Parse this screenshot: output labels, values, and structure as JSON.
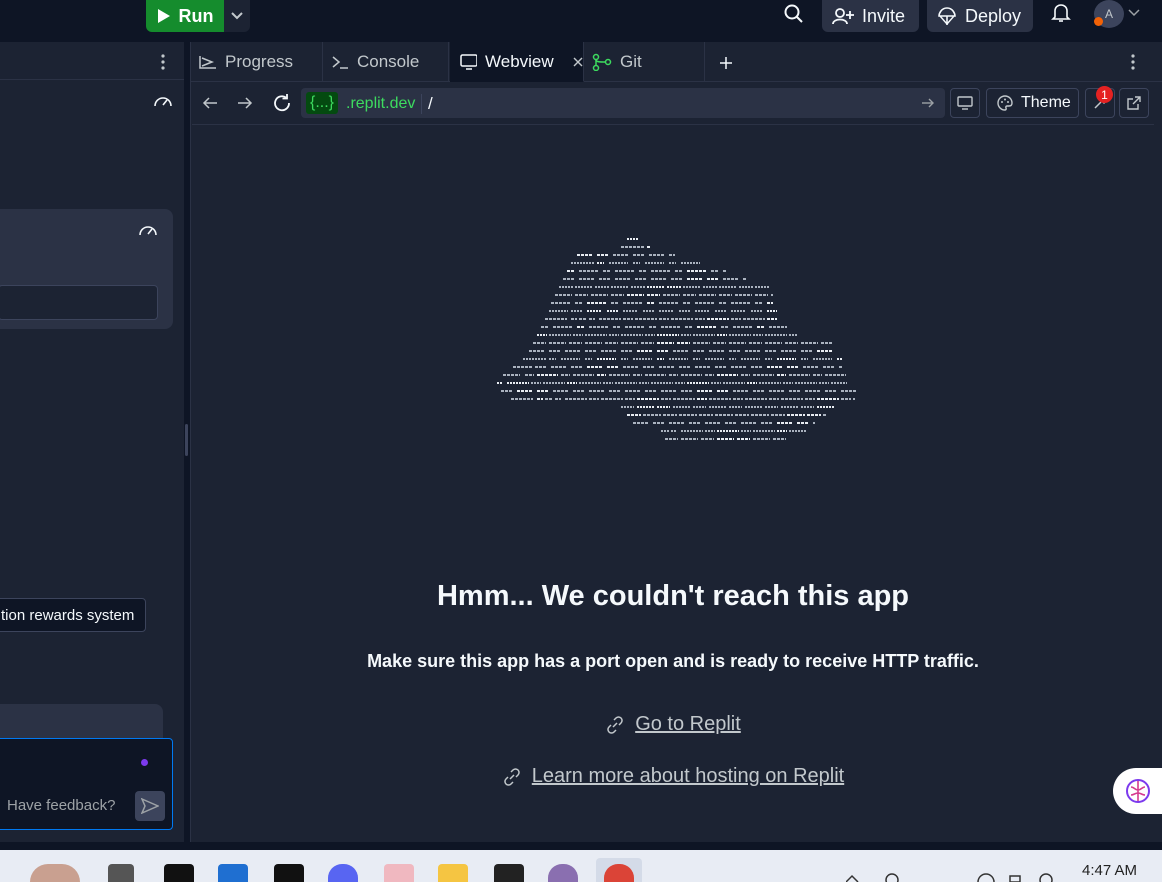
{
  "topbar": {
    "run_label": "Run",
    "invite_label": "Invite",
    "deploy_label": "Deploy",
    "avatar_initial": "A"
  },
  "left_panel": {
    "reward_text": "tion rewards system",
    "feedback_placeholder": "Have feedback?"
  },
  "tabs": [
    {
      "label": "Progress",
      "icon": "progress-icon"
    },
    {
      "label": "Console",
      "icon": "terminal-icon"
    },
    {
      "label": "Webview",
      "icon": "monitor-icon",
      "active": true
    },
    {
      "label": "Git",
      "icon": "git-icon"
    }
  ],
  "urlbar": {
    "badge": "{...}",
    "domain": ".replit.dev",
    "path": "/",
    "theme_label": "Theme",
    "notification_count": "1"
  },
  "webview": {
    "heading": "Hmm... We couldn't reach this app",
    "subtext": "Make sure this app has a port open and is ready to receive HTTP traffic.",
    "link1": "Go to Replit",
    "link2": "Learn more about hosting on Replit"
  },
  "taskbar": {
    "time": "4:47 AM"
  },
  "colors": {
    "run_green": "#158c2d",
    "url_green": "#3ddb5f",
    "focus_blue": "#0079f2",
    "badge_red": "#e52222"
  }
}
